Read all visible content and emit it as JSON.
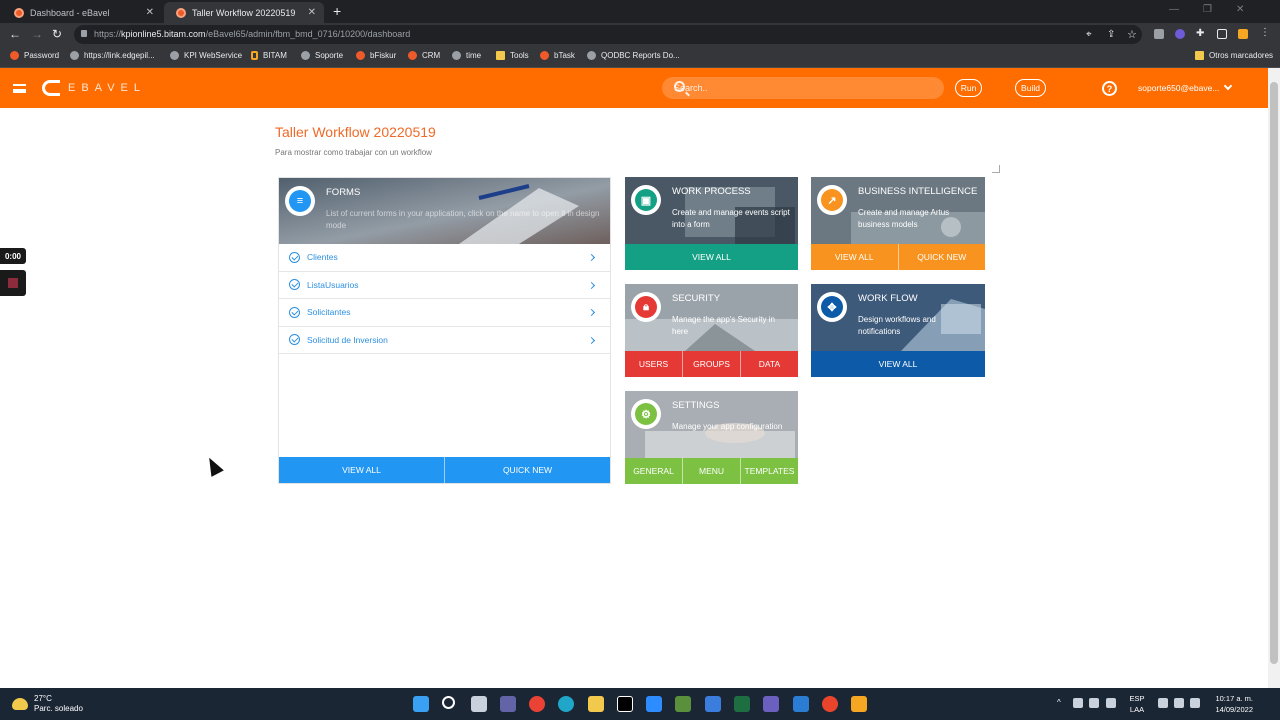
{
  "browser": {
    "tabs": [
      {
        "title": "Dashboard - eBavel",
        "active": false
      },
      {
        "title": "Taller Workflow 20220519",
        "active": true
      }
    ],
    "url_prefix": "https://",
    "url_host": "kpionline5.bitam.com",
    "url_path": "/eBavel65/admin/fbm_bmd_0716/10200/dashboard",
    "bookmarks": [
      "Password",
      "https://link.edgepil...",
      "KPI WebService",
      "BITAM",
      "Soporte",
      "bFiskur",
      "CRM",
      "time",
      "Tools",
      "bTask",
      "QODBC Reports Do..."
    ],
    "other_bookmarks": "Otros marcadores"
  },
  "header": {
    "logo_text": "EBAVEL",
    "search_placeholder": "Search..",
    "run_label": "Run",
    "build_label": "Build",
    "help_label": "?",
    "user": "soporte650@ebave..."
  },
  "page": {
    "title": "Taller Workflow 20220519",
    "subtitle": "Para mostrar como trabajar con un workflow"
  },
  "forms_card": {
    "title": "FORMS",
    "description": "List of current forms in your application, click on the name to open it in design mode",
    "items": [
      "Clientes",
      "ListaUsuarios",
      "Solicitantes",
      "Solicitud de Inversion"
    ],
    "view_all": "VIEW ALL",
    "quick_new": "QUICK NEW",
    "color": "#2196f3"
  },
  "work_process": {
    "title": "WORK PROCESS",
    "description": "Create and manage events script into a form",
    "view_all": "VIEW ALL",
    "color": "#14a085"
  },
  "business_intelligence": {
    "title": "BUSINESS INTELLIGENCE",
    "description": "Create and manage Artus business models",
    "view_all": "VIEW ALL",
    "quick_new": "QUICK NEW",
    "color": "#f7931e"
  },
  "security": {
    "title": "SECURITY",
    "description": "Manage the app's Security in here",
    "buttons": [
      "USERS",
      "GROUPS",
      "DATA"
    ],
    "color": "#e53935"
  },
  "workflow": {
    "title": "WORK FLOW",
    "description": "Design workflows and notifications",
    "view_all": "VIEW ALL",
    "color": "#0d5ba8"
  },
  "settings": {
    "title": "SETTINGS",
    "description": "Manage your app configuration",
    "buttons": [
      "GENERAL",
      "MENU",
      "TEMPLATES"
    ],
    "color": "#7cc142"
  },
  "recorder": {
    "time": "0:00"
  },
  "taskbar": {
    "temp": "27°C",
    "weather": "Parc. soleado",
    "lang1": "ESP",
    "lang2": "LAA",
    "time": "10:17 a. m.",
    "date": "14/09/2022"
  }
}
